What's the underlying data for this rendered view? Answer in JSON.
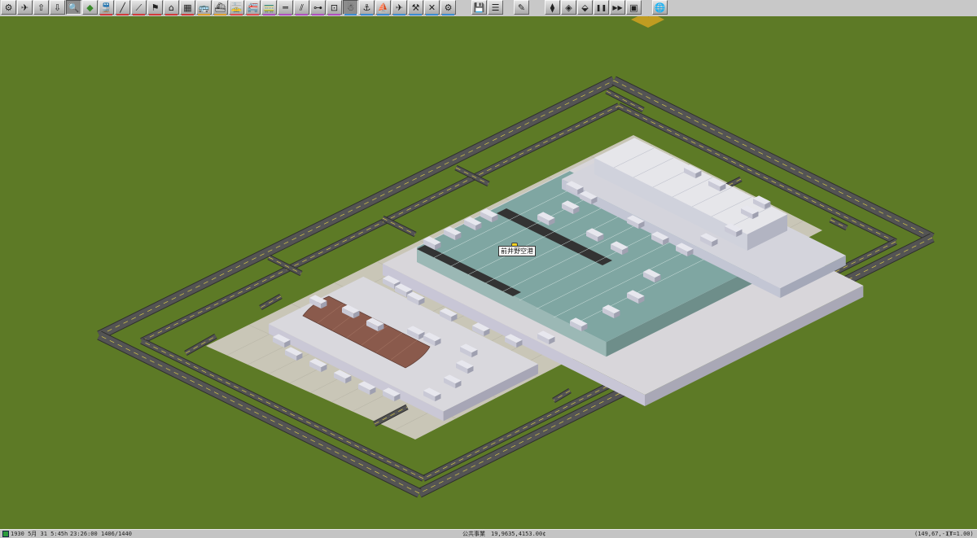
{
  "toolbar": {
    "groups": [
      {
        "name": "general-tools",
        "buttons": [
          {
            "name": "settings-gear-icon",
            "glyph": "⚙",
            "active": false
          },
          {
            "name": "map-overview-icon",
            "glyph": "✈",
            "active": false
          },
          {
            "name": "raise-land-icon",
            "glyph": "⇧",
            "active": false
          },
          {
            "name": "lower-land-icon",
            "glyph": "⇩",
            "active": false
          },
          {
            "name": "query-magnifier-icon",
            "glyph": "🔍",
            "active": true
          },
          {
            "name": "landscape-tools-icon",
            "glyph": "◆",
            "active": false,
            "color": "#3a8a2a"
          }
        ]
      },
      {
        "name": "rail-tools",
        "strip": "#d23c3c",
        "buttons": [
          {
            "name": "rail-vehicles-icon",
            "glyph": "🚆",
            "active": false
          },
          {
            "name": "rail-track-icon",
            "glyph": "╱",
            "active": false
          },
          {
            "name": "rail-bridge-icon",
            "glyph": "⟋",
            "active": false
          },
          {
            "name": "rail-signal-icon",
            "glyph": "⚑",
            "active": false
          },
          {
            "name": "rail-depot-icon",
            "glyph": "⌂",
            "active": false
          },
          {
            "name": "rail-station-icon",
            "glyph": "▦",
            "active": false
          }
        ]
      },
      {
        "name": "road-tools",
        "strip": "#e0a030",
        "buttons": [
          {
            "name": "bus-icon",
            "glyph": "🚌",
            "active": false
          },
          {
            "name": "ship-icon",
            "glyph": "⛴",
            "active": false
          }
        ]
      },
      {
        "name": "tram-tools",
        "strip": "#e05050",
        "buttons": [
          {
            "name": "tram-icon",
            "glyph": "🚋",
            "active": false
          },
          {
            "name": "monorail-icon",
            "glyph": "🚝",
            "active": false
          }
        ]
      },
      {
        "name": "narrowgauge-tools",
        "strip": "#b050c0",
        "buttons": [
          {
            "name": "narrow-gauge-train-icon",
            "glyph": "🚃",
            "active": false
          },
          {
            "name": "narrow-gauge-track-icon",
            "glyph": "═",
            "active": false
          },
          {
            "name": "narrow-gauge-bridge-icon",
            "glyph": "⫽",
            "active": false
          },
          {
            "name": "narrow-gauge-signal-icon",
            "glyph": "⊶",
            "active": false
          },
          {
            "name": "narrow-gauge-station-icon",
            "glyph": "⊡",
            "active": false
          }
        ]
      },
      {
        "name": "water-air-tools",
        "strip": "#3c8cd2",
        "buttons": [
          {
            "name": "snowman-icon",
            "glyph": "☃",
            "active": true
          },
          {
            "name": "harbour-icon",
            "glyph": "⚓",
            "active": false
          },
          {
            "name": "dock-icon",
            "glyph": "⛵",
            "active": false
          },
          {
            "name": "airplane-icon",
            "glyph": "✈",
            "active": false
          },
          {
            "name": "crane-icon",
            "glyph": "⚒",
            "active": false
          },
          {
            "name": "remove-tool-icon",
            "glyph": "✕",
            "active": false
          },
          {
            "name": "special-tools-gear-icon",
            "glyph": "⚙",
            "active": false
          }
        ]
      },
      {
        "name": "file-tools",
        "buttons": [
          {
            "name": "save-disk-icon",
            "glyph": "💾",
            "active": false
          },
          {
            "name": "list-icon",
            "glyph": "☰",
            "active": false
          }
        ]
      },
      {
        "name": "edit-tools",
        "buttons": [
          {
            "name": "edit-pen-icon",
            "glyph": "✎",
            "active": false
          }
        ]
      },
      {
        "name": "view-tools",
        "buttons": [
          {
            "name": "layer-up-icon",
            "glyph": "⧫",
            "active": false
          },
          {
            "name": "layer-view-icon",
            "glyph": "◈",
            "active": false
          },
          {
            "name": "layer-down-icon",
            "glyph": "⬙",
            "active": false
          },
          {
            "name": "pause-icon",
            "glyph": "❚❚",
            "active": false
          },
          {
            "name": "fast-forward-icon",
            "glyph": "▶▶",
            "active": false
          },
          {
            "name": "screenshot-icon",
            "glyph": "▣",
            "active": false
          }
        ]
      },
      {
        "name": "network-tools",
        "buttons": [
          {
            "name": "globe-icon",
            "glyph": "🌐",
            "active": false
          }
        ]
      }
    ]
  },
  "map": {
    "station_name": "前井野空港",
    "colors": {
      "grass": "#5d7a26",
      "apron": "#c9c6b7",
      "taxiway": "#545454",
      "runway_edge": "#2f2f2f",
      "terminal_wall": "#d2d3dc",
      "glass_roof": "#7fa6a2",
      "dark_roof": "#333333",
      "dome_roof": "#8a5a4c",
      "white_roof": "#e6e6ea"
    }
  },
  "statusbar": {
    "date": "1930 5月 31  5:45h",
    "clock": "23:26:00",
    "counter": "1406/1440",
    "company": "公共事業",
    "money": "19,9635,4153.00¢",
    "coords": "(149,67,-1)",
    "timescale": "(T=1.00)"
  }
}
